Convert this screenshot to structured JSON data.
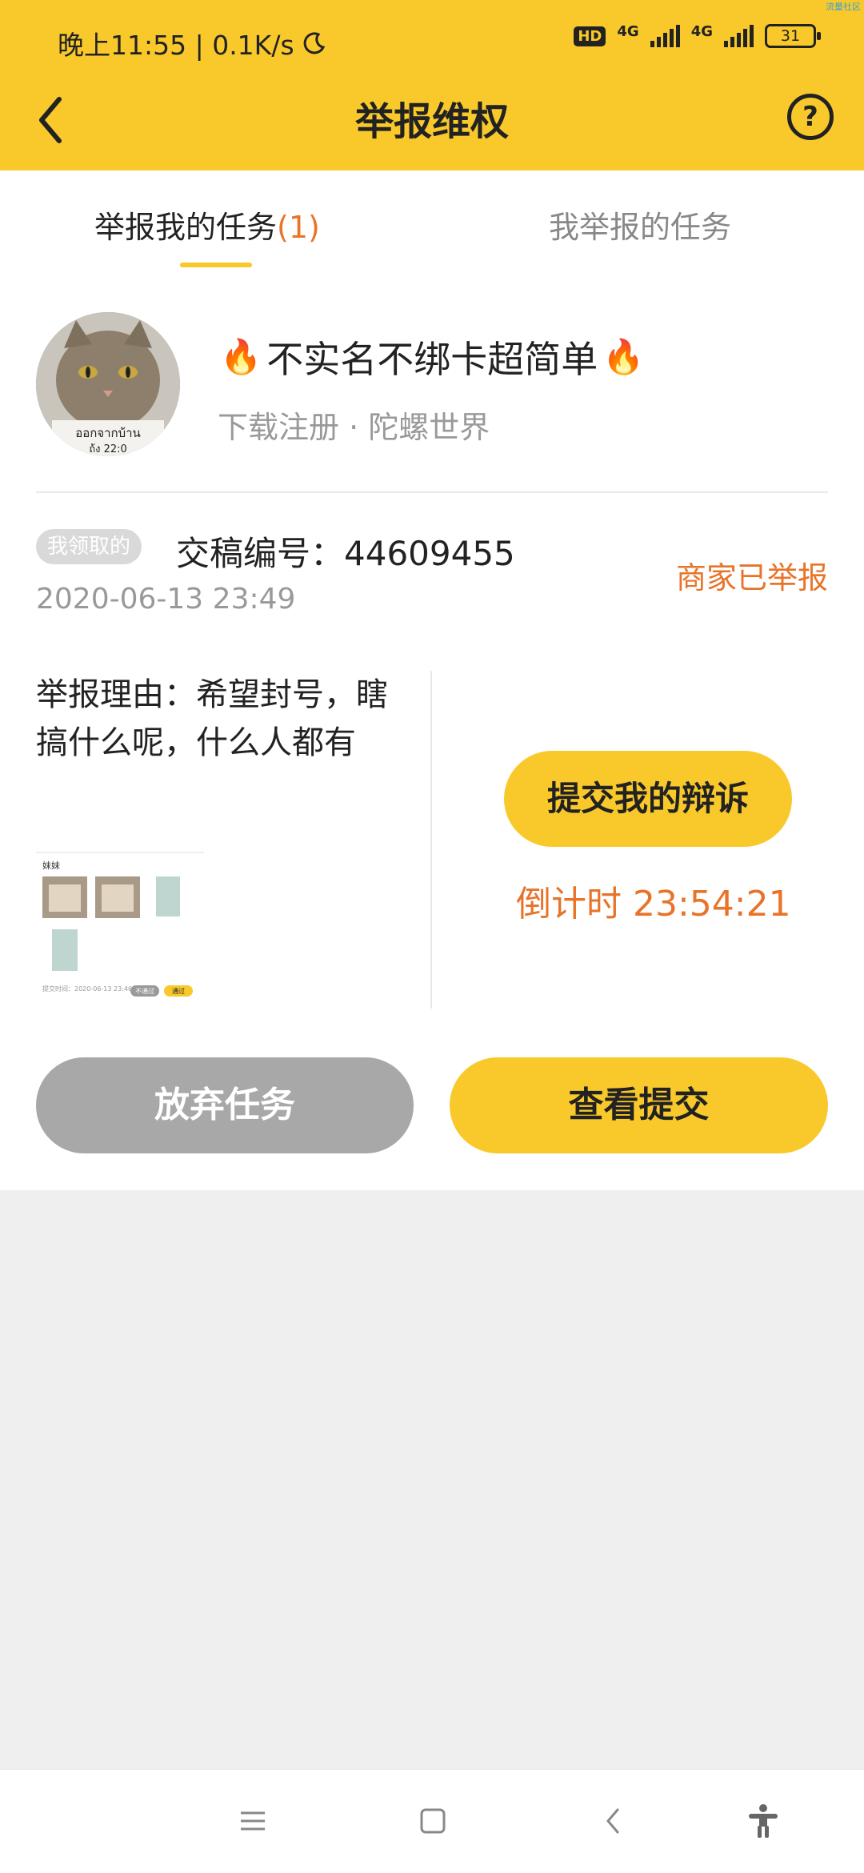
{
  "status_bar": {
    "time_speed": "晚上11:55 | 0.1K/s",
    "network_badge": "HD",
    "net1": "4G",
    "net2": "4G",
    "battery": "31",
    "moon_icon": "moon-icon",
    "corner_tag": "流量社区"
  },
  "header": {
    "title": "举报维权",
    "back_icon": "chevron-left-icon",
    "help_icon": "help-icon",
    "help_glyph": "?"
  },
  "tabs": [
    {
      "label": "举报我的任务",
      "count": "(1)",
      "active": true
    },
    {
      "label": "我举报的任务",
      "active": false
    }
  ],
  "task": {
    "fire_icon": "🔥",
    "title": "不实名不绑卡超简单",
    "meta": "下载注册 · 陀螺世界",
    "avatar_caption_1": "ออกจากบ้าน",
    "avatar_caption_2": "ถ้ง 22:0"
  },
  "report": {
    "claim_tag": "我领取的",
    "submission_no": "交稿编号：44609455",
    "time": "2020-06-13 23:49",
    "status": "商家已举报",
    "reason": "举报理由：希望封号，瞎搞什么呢，什么人都有",
    "screenshot": {
      "name": "妹妹",
      "submit_time": "提交时间：2020-06-13 23:46",
      "tag_reject": "不通过",
      "tag_pass": "通过"
    },
    "appeal_button": "提交我的辩诉",
    "countdown": "倒计时 23:54:21"
  },
  "actions": {
    "give_up": "放弃任务",
    "view_submission": "查看提交"
  },
  "nav": {
    "menu_icon": "menu-icon",
    "home_icon": "home-square-icon",
    "back_icon": "back-icon",
    "accessibility_icon": "accessibility-icon"
  },
  "colors": {
    "brand_yellow": "#f9c92b",
    "accent_orange": "#e8742a",
    "muted_gray": "#999999"
  }
}
